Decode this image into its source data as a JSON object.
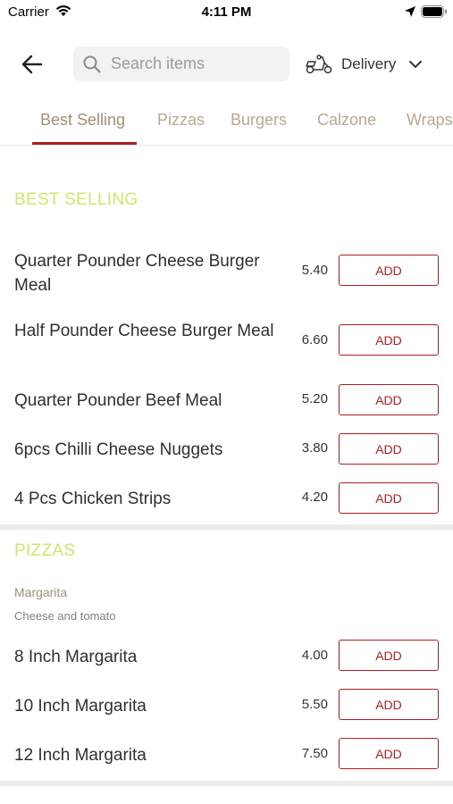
{
  "status_bar": {
    "carrier": "Carrier",
    "time": "4:11 PM"
  },
  "header": {
    "search_placeholder": "Search items",
    "delivery_label": "Delivery"
  },
  "tabs": [
    {
      "label": "Best Selling",
      "active": true
    },
    {
      "label": "Pizzas",
      "active": false
    },
    {
      "label": "Burgers",
      "active": false
    },
    {
      "label": "Calzone",
      "active": false
    },
    {
      "label": "Wraps",
      "active": false
    }
  ],
  "colors": {
    "accent": "#b01e23",
    "section_title": "#d4e56b",
    "tab_text": "#b8a994"
  },
  "best_selling": {
    "title": "BEST SELLING",
    "items": [
      {
        "name": "Quarter Pounder Cheese Burger Meal",
        "price": "5.40",
        "button": "ADD"
      },
      {
        "name": "Half Pounder Cheese Burger Meal",
        "price": "6.60",
        "button": "ADD"
      },
      {
        "name": "Quarter Pounder Beef Meal",
        "price": "5.20",
        "button": "ADD"
      },
      {
        "name": "6pcs Chilli Cheese Nuggets",
        "price": "3.80",
        "button": "ADD"
      },
      {
        "name": "4 Pcs Chicken Strips",
        "price": "4.20",
        "button": "ADD"
      }
    ]
  },
  "pizzas": {
    "title": "PIZZAS",
    "group_name": "Margarita",
    "group_desc": "Cheese and tomato",
    "items": [
      {
        "name": "8 Inch Margarita",
        "price": "4.00",
        "button": "ADD"
      },
      {
        "name": "10 Inch Margarita",
        "price": "5.50",
        "button": "ADD"
      },
      {
        "name": "12 Inch Margarita",
        "price": "7.50",
        "button": "ADD"
      }
    ]
  }
}
